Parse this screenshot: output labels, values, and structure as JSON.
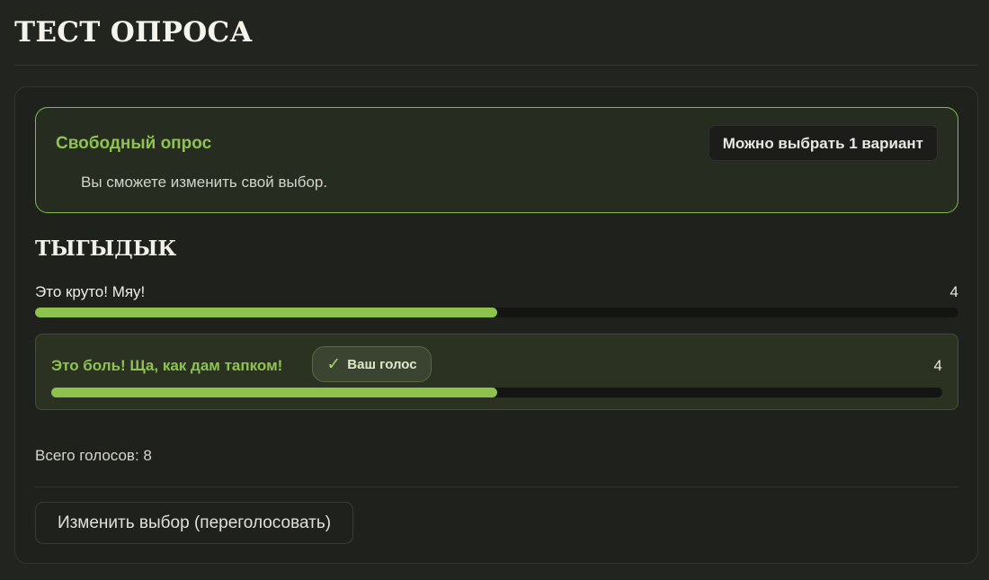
{
  "page": {
    "title": "ТЕСТ ОПРОСА"
  },
  "info": {
    "heading": "Свободный опрос",
    "badge": "Можно выбрать 1 вариант",
    "note": "Вы сможете изменить свой выбор."
  },
  "question": {
    "title": "ТЫГЫДЫК"
  },
  "options": [
    {
      "label": "Это круто! Мяу!",
      "count": "4",
      "share": 0.5,
      "voted": false
    },
    {
      "label": "Это боль! Ща, как дам тапком!",
      "count": "4",
      "share": 0.5,
      "voted": true,
      "vote_badge": "Ваш голос"
    }
  ],
  "icons": {
    "vote_check": "check-icon"
  },
  "colors": {
    "accent": "#8dc34d",
    "background": "#22241f",
    "card": "#1f211c"
  },
  "total": {
    "text": "Всего голосов: 8"
  },
  "actions": {
    "revote_label": "Изменить выбор (переголосовать)"
  }
}
